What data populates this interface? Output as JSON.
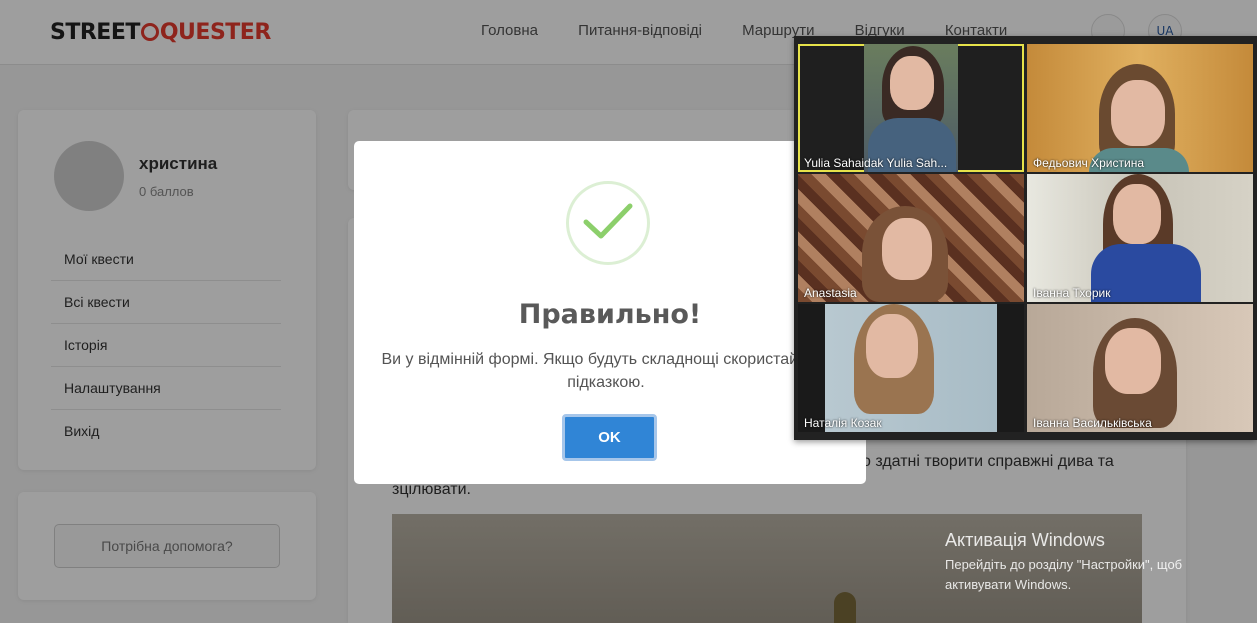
{
  "app": {
    "logo_part1": "STREET",
    "logo_part2": "QUESTER"
  },
  "nav": {
    "items": [
      "Головна",
      "Питання-відповіді",
      "Маршрути",
      "Відгуки",
      "Контакти"
    ],
    "lang": "UA"
  },
  "profile": {
    "username": "христина",
    "points": "0 баллов"
  },
  "menu": {
    "items": [
      "Мої квести",
      "Всі квести",
      "Історія",
      "Налаштування",
      "Вихід"
    ]
  },
  "help": {
    "button_label": "Потрібна допомога?"
  },
  "content": {
    "text_line1": "о здатні творити справжні дива та",
    "text_line2": "зцілювати."
  },
  "modal": {
    "title": "Правильно!",
    "message": "Ви у відмінній формі. Якщо будуть складнощі скористайтесь підказкою.",
    "ok_label": "OK"
  },
  "video_call": {
    "participants": [
      "Yulia Sahaidak Yulia Sah...",
      "Федьович Христина",
      "Anastasia",
      "Іванна Тхорик",
      "Наталія Козак",
      "Іванна Васильківська"
    ]
  },
  "watermark": {
    "title": "Активація Windows",
    "text": "Перейдіть до розділу \"Настройки\", щоб активувати Windows."
  },
  "colors": {
    "accent": "#3085d6",
    "brand_red": "#e63a2e",
    "success_green": "#8ccf6b"
  }
}
